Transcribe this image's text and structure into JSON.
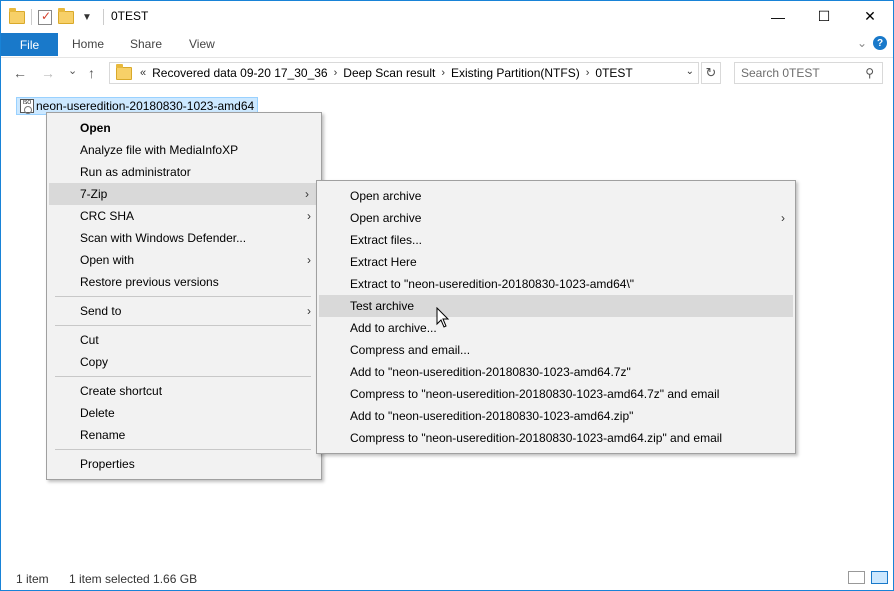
{
  "window": {
    "title": "0TEST"
  },
  "window_buttons": {
    "minimize": "—",
    "maximize": "☐",
    "close": "✕"
  },
  "ribbon": {
    "tabs": [
      "File",
      "Home",
      "Share",
      "View"
    ],
    "help": "?"
  },
  "nav": {
    "back": "←",
    "forward": "→",
    "recent": "⌄",
    "up": "↑",
    "overflow": "«",
    "breadcrumb": [
      "Recovered data 09-20 17_30_36",
      "Deep Scan result",
      "Existing Partition(NTFS)",
      "0TEST"
    ],
    "breadcrumb_sep": "›"
  },
  "search": {
    "placeholder": "Search 0TEST"
  },
  "file": {
    "name": "neon-useredition-20180830-1023-amd64",
    "icon": "iso-file-icon",
    "icon_text": "ISO"
  },
  "context_menu": {
    "items": [
      {
        "label": "Open",
        "bold": true,
        "has_submenu": false
      },
      {
        "label": "Analyze file with MediaInfoXP",
        "has_submenu": false
      },
      {
        "label": "Run as administrator",
        "has_submenu": false
      },
      {
        "label": "7-Zip",
        "has_submenu": true,
        "highlighted": true
      },
      {
        "label": "CRC SHA",
        "has_submenu": true
      },
      {
        "label": "Scan with Windows Defender...",
        "has_submenu": false
      },
      {
        "label": "Open with",
        "has_submenu": true
      },
      {
        "label": "Restore previous versions",
        "has_submenu": false
      },
      {
        "separator": true
      },
      {
        "label": "Send to",
        "has_submenu": true
      },
      {
        "separator": true
      },
      {
        "label": "Cut",
        "has_submenu": false
      },
      {
        "label": "Copy",
        "has_submenu": false
      },
      {
        "separator": true
      },
      {
        "label": "Create shortcut",
        "has_submenu": false
      },
      {
        "label": "Delete",
        "has_submenu": false
      },
      {
        "label": "Rename",
        "has_submenu": false
      },
      {
        "separator": true
      },
      {
        "label": "Properties",
        "has_submenu": false
      }
    ]
  },
  "submenu_7zip": {
    "items": [
      {
        "label": "Open archive",
        "has_submenu": false
      },
      {
        "label": "Open archive",
        "has_submenu": true
      },
      {
        "label": "Extract files...",
        "has_submenu": false
      },
      {
        "label": "Extract Here",
        "has_submenu": false
      },
      {
        "label": "Extract to \"neon-useredition-20180830-1023-amd64\\\"",
        "has_submenu": false
      },
      {
        "label": "Test archive",
        "has_submenu": false,
        "highlighted": true
      },
      {
        "label": "Add to archive...",
        "has_submenu": false
      },
      {
        "label": "Compress and email...",
        "has_submenu": false
      },
      {
        "label": "Add to \"neon-useredition-20180830-1023-amd64.7z\"",
        "has_submenu": false
      },
      {
        "label": "Compress to \"neon-useredition-20180830-1023-amd64.7z\" and email",
        "has_submenu": false
      },
      {
        "label": "Add to \"neon-useredition-20180830-1023-amd64.zip\"",
        "has_submenu": false
      },
      {
        "label": "Compress to \"neon-useredition-20180830-1023-amd64.zip\" and email",
        "has_submenu": false
      }
    ]
  },
  "status": {
    "count": "1 item",
    "selection": "1 item selected  1.66 GB"
  },
  "colors": {
    "accent": "#1979ca",
    "selection": "#cce8ff",
    "menu_bg": "#f2f2f2",
    "menu_highlight": "#d9d9d9"
  }
}
